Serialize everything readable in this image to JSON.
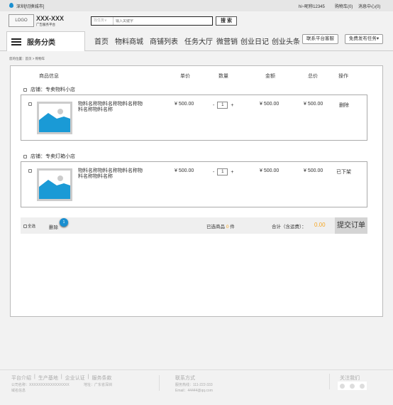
{
  "topbar": {
    "city": "深圳[切换城市]",
    "user": "hi~昵称12345",
    "cart": "购物车(0)",
    "messages": "消息中心(0)"
  },
  "header": {
    "logo": "LOGO",
    "brand": "XXX-XXX",
    "slogan": "广告服务平台",
    "search_type": "找任务∨",
    "search_placeholder": "输入关键字",
    "search_button": "搜 索"
  },
  "nav": {
    "category": "服务分类",
    "items": [
      "首页",
      "物料商城",
      "商铺列表",
      "任务大厅",
      "微营销",
      "创业日记",
      "创业头条"
    ],
    "contact": "联系平台客服",
    "publish": "免费发布任务▾"
  },
  "breadcrumb": "您的位置：首页 > 购物车",
  "table": {
    "headers": [
      "商品信息",
      "单价",
      "数量",
      "金额",
      "总价",
      "操作"
    ]
  },
  "stores": [
    {
      "name": "店铺：专卖物料小店",
      "item": {
        "name": "物料名称物料名称物料名称物料名称物料名称",
        "price": "¥ 500.00",
        "qty": "1",
        "amount": "¥ 500.00",
        "total": "¥ 500.00",
        "action": "删除"
      }
    },
    {
      "name": "店铺：专卖灯箱小店",
      "item": {
        "name": "物料名称物料名称物料名称物料名称物料名称",
        "price": "¥ 500.00",
        "qty": "1",
        "amount": "¥ 500.00",
        "total": "¥ 500.00",
        "action": "已下架"
      }
    }
  ],
  "qty_minus": "-",
  "qty_plus": "+",
  "summary": {
    "select_all": "全选",
    "delete": "删除",
    "badge": "1",
    "selected_prefix": "已选商品",
    "selected_count": "0",
    "selected_suffix": "件",
    "total_label": "合计（含运费）：",
    "total": "0.00",
    "submit": "提交订单"
  },
  "colors": {
    "accent": "#f5a623",
    "blue": "#1a8fd0"
  },
  "footer": {
    "links": [
      "平台介绍",
      "生产基地",
      "企业认证",
      "服务条款"
    ],
    "company": "公司名称：XXXXXXXXXXXXXXXXX",
    "address": "地址：广东省深圳",
    "domain": "域名信息",
    "contact_title": "联系方式",
    "hotline": "服务热线：111-222-333",
    "email": "Email：44444@qq.com",
    "follow": "关注我们"
  }
}
